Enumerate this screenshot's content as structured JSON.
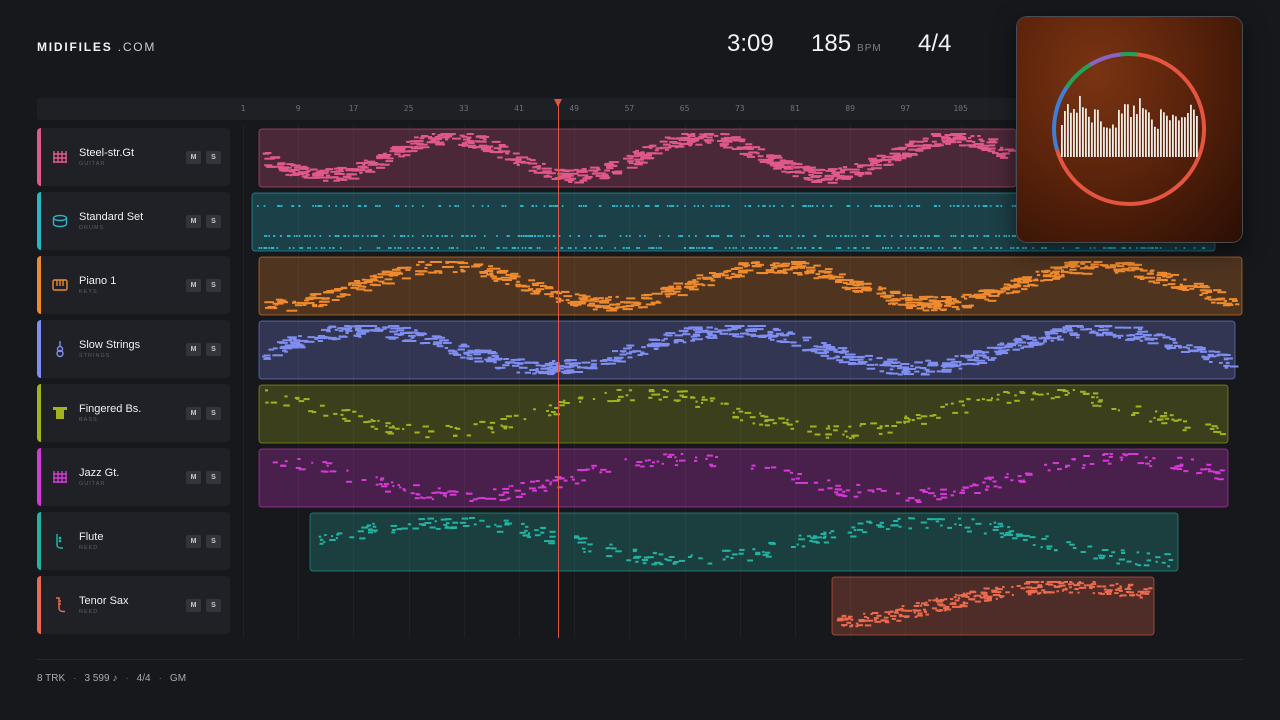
{
  "brand": {
    "name": "MIDIFILES",
    "suffix": ".COM"
  },
  "transport": {
    "time": "3:09",
    "tempo": "185",
    "tempo_unit": "BPM",
    "time_signature": "4/4"
  },
  "ruler": {
    "ticks": [
      "1",
      "9",
      "17",
      "25",
      "33",
      "41",
      "49",
      "57",
      "65",
      "73",
      "81",
      "89",
      "97",
      "105"
    ]
  },
  "playhead": {
    "bar": 46.6
  },
  "tracks": [
    {
      "name": "Steel-str.Gt",
      "category": "GUITAR",
      "color": "#e0598a",
      "icon": "guitar-grid-icon",
      "mute": "M",
      "solo": "S"
    },
    {
      "name": "Standard Set",
      "category": "DRUMS",
      "color": "#29b6c6",
      "icon": "drum-icon",
      "mute": "M",
      "solo": "S"
    },
    {
      "name": "Piano 1",
      "category": "KEYS",
      "color": "#ef8a2e",
      "icon": "piano-icon",
      "mute": "M",
      "solo": "S"
    },
    {
      "name": "Slow Strings",
      "category": "STRINGS",
      "color": "#7f8ef0",
      "icon": "violin-icon",
      "mute": "M",
      "solo": "S"
    },
    {
      "name": "Fingered Bs.",
      "category": "BASS",
      "color": "#a3b31e",
      "icon": "bass-amp-icon",
      "mute": "M",
      "solo": "S"
    },
    {
      "name": "Jazz Gt.",
      "category": "GUITAR",
      "color": "#d63ad6",
      "icon": "guitar-grid-icon",
      "mute": "M",
      "solo": "S"
    },
    {
      "name": "Flute",
      "category": "REED",
      "color": "#22b3a2",
      "icon": "flute-icon",
      "mute": "M",
      "solo": "S"
    },
    {
      "name": "Tenor Sax",
      "category": "REED",
      "color": "#ec6a4e",
      "icon": "sax-icon",
      "mute": "M",
      "solo": "S"
    }
  ],
  "footer": {
    "tracks": "8 TRK",
    "notes": "3 599 ♪",
    "signature": "4/4",
    "standard": "GM"
  },
  "album_art": {
    "ring_colors": [
      "#e4543f",
      "#3f7fd6",
      "#1fa35a",
      "#8a64c4"
    ],
    "bar_color": "#f3ede6"
  }
}
